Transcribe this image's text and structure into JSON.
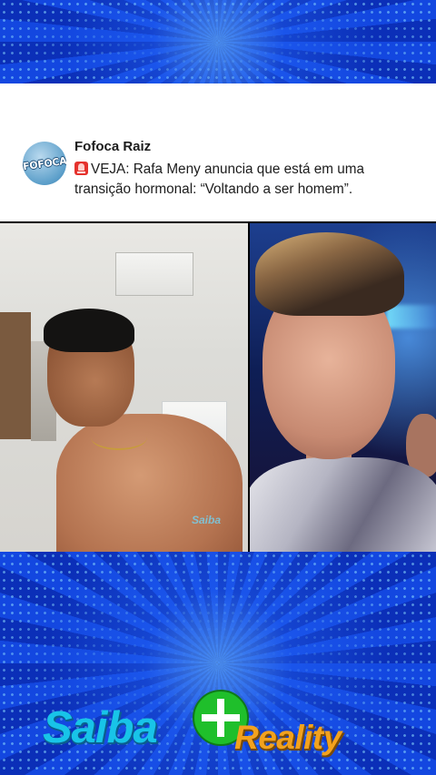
{
  "post": {
    "account_name": "Fofoca Raiz",
    "avatar_text": "FOFOCA",
    "icon": "siren-icon",
    "text": "VEJA: Rafa Meny anuncia que está em uma transição hormonal: “Voltando a ser homem”."
  },
  "video": {
    "watermark": "Saiba"
  },
  "logo": {
    "part1": "Saiba",
    "part2": "Reality",
    "colors": {
      "saiba": "#18c4e8",
      "plus": "#1fbf2b",
      "reality": "#f3a21e"
    }
  },
  "colors": {
    "background": "#0b2fb8",
    "card": "#ffffff"
  }
}
